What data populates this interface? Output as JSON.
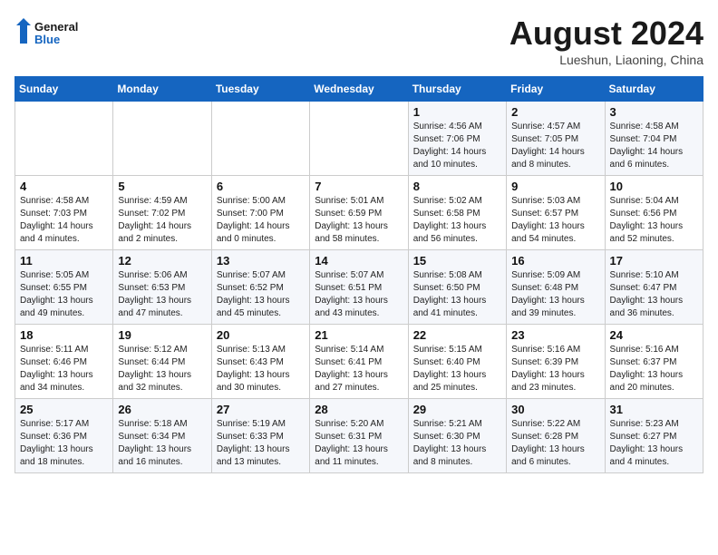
{
  "header": {
    "logo_line1": "General",
    "logo_line2": "Blue",
    "month_title": "August 2024",
    "subtitle": "Lueshun, Liaoning, China"
  },
  "days_of_week": [
    "Sunday",
    "Monday",
    "Tuesday",
    "Wednesday",
    "Thursday",
    "Friday",
    "Saturday"
  ],
  "weeks": [
    [
      {
        "day": "",
        "info": ""
      },
      {
        "day": "",
        "info": ""
      },
      {
        "day": "",
        "info": ""
      },
      {
        "day": "",
        "info": ""
      },
      {
        "day": "1",
        "info": "Sunrise: 4:56 AM\nSunset: 7:06 PM\nDaylight: 14 hours\nand 10 minutes."
      },
      {
        "day": "2",
        "info": "Sunrise: 4:57 AM\nSunset: 7:05 PM\nDaylight: 14 hours\nand 8 minutes."
      },
      {
        "day": "3",
        "info": "Sunrise: 4:58 AM\nSunset: 7:04 PM\nDaylight: 14 hours\nand 6 minutes."
      }
    ],
    [
      {
        "day": "4",
        "info": "Sunrise: 4:58 AM\nSunset: 7:03 PM\nDaylight: 14 hours\nand 4 minutes."
      },
      {
        "day": "5",
        "info": "Sunrise: 4:59 AM\nSunset: 7:02 PM\nDaylight: 14 hours\nand 2 minutes."
      },
      {
        "day": "6",
        "info": "Sunrise: 5:00 AM\nSunset: 7:00 PM\nDaylight: 14 hours\nand 0 minutes."
      },
      {
        "day": "7",
        "info": "Sunrise: 5:01 AM\nSunset: 6:59 PM\nDaylight: 13 hours\nand 58 minutes."
      },
      {
        "day": "8",
        "info": "Sunrise: 5:02 AM\nSunset: 6:58 PM\nDaylight: 13 hours\nand 56 minutes."
      },
      {
        "day": "9",
        "info": "Sunrise: 5:03 AM\nSunset: 6:57 PM\nDaylight: 13 hours\nand 54 minutes."
      },
      {
        "day": "10",
        "info": "Sunrise: 5:04 AM\nSunset: 6:56 PM\nDaylight: 13 hours\nand 52 minutes."
      }
    ],
    [
      {
        "day": "11",
        "info": "Sunrise: 5:05 AM\nSunset: 6:55 PM\nDaylight: 13 hours\nand 49 minutes."
      },
      {
        "day": "12",
        "info": "Sunrise: 5:06 AM\nSunset: 6:53 PM\nDaylight: 13 hours\nand 47 minutes."
      },
      {
        "day": "13",
        "info": "Sunrise: 5:07 AM\nSunset: 6:52 PM\nDaylight: 13 hours\nand 45 minutes."
      },
      {
        "day": "14",
        "info": "Sunrise: 5:07 AM\nSunset: 6:51 PM\nDaylight: 13 hours\nand 43 minutes."
      },
      {
        "day": "15",
        "info": "Sunrise: 5:08 AM\nSunset: 6:50 PM\nDaylight: 13 hours\nand 41 minutes."
      },
      {
        "day": "16",
        "info": "Sunrise: 5:09 AM\nSunset: 6:48 PM\nDaylight: 13 hours\nand 39 minutes."
      },
      {
        "day": "17",
        "info": "Sunrise: 5:10 AM\nSunset: 6:47 PM\nDaylight: 13 hours\nand 36 minutes."
      }
    ],
    [
      {
        "day": "18",
        "info": "Sunrise: 5:11 AM\nSunset: 6:46 PM\nDaylight: 13 hours\nand 34 minutes."
      },
      {
        "day": "19",
        "info": "Sunrise: 5:12 AM\nSunset: 6:44 PM\nDaylight: 13 hours\nand 32 minutes."
      },
      {
        "day": "20",
        "info": "Sunrise: 5:13 AM\nSunset: 6:43 PM\nDaylight: 13 hours\nand 30 minutes."
      },
      {
        "day": "21",
        "info": "Sunrise: 5:14 AM\nSunset: 6:41 PM\nDaylight: 13 hours\nand 27 minutes."
      },
      {
        "day": "22",
        "info": "Sunrise: 5:15 AM\nSunset: 6:40 PM\nDaylight: 13 hours\nand 25 minutes."
      },
      {
        "day": "23",
        "info": "Sunrise: 5:16 AM\nSunset: 6:39 PM\nDaylight: 13 hours\nand 23 minutes."
      },
      {
        "day": "24",
        "info": "Sunrise: 5:16 AM\nSunset: 6:37 PM\nDaylight: 13 hours\nand 20 minutes."
      }
    ],
    [
      {
        "day": "25",
        "info": "Sunrise: 5:17 AM\nSunset: 6:36 PM\nDaylight: 13 hours\nand 18 minutes."
      },
      {
        "day": "26",
        "info": "Sunrise: 5:18 AM\nSunset: 6:34 PM\nDaylight: 13 hours\nand 16 minutes."
      },
      {
        "day": "27",
        "info": "Sunrise: 5:19 AM\nSunset: 6:33 PM\nDaylight: 13 hours\nand 13 minutes."
      },
      {
        "day": "28",
        "info": "Sunrise: 5:20 AM\nSunset: 6:31 PM\nDaylight: 13 hours\nand 11 minutes."
      },
      {
        "day": "29",
        "info": "Sunrise: 5:21 AM\nSunset: 6:30 PM\nDaylight: 13 hours\nand 8 minutes."
      },
      {
        "day": "30",
        "info": "Sunrise: 5:22 AM\nSunset: 6:28 PM\nDaylight: 13 hours\nand 6 minutes."
      },
      {
        "day": "31",
        "info": "Sunrise: 5:23 AM\nSunset: 6:27 PM\nDaylight: 13 hours\nand 4 minutes."
      }
    ]
  ]
}
